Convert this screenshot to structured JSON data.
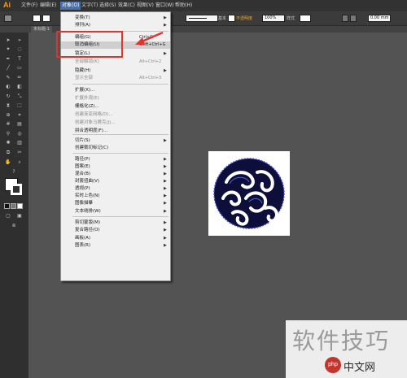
{
  "app": {
    "logo": "Ai"
  },
  "menubar": {
    "items": [
      "文件(F)",
      "编辑(E)",
      "对象(O)",
      "文字(T)",
      "选择(S)",
      "效果(C)",
      "视图(V)",
      "窗口(W)",
      "帮助(H)"
    ]
  },
  "controlbar": {
    "stroke_label": "基本",
    "opacity_label": "不透明度",
    "zoom_value": "100%",
    "style_label": "样式",
    "coord_value": "0.00 mm"
  },
  "tab": {
    "label": "未标题-1"
  },
  "object_menu": {
    "items": [
      {
        "label": "变换(T)",
        "shortcut": "",
        "submenu": true,
        "disabled": false
      },
      {
        "label": "排列(A)",
        "shortcut": "",
        "submenu": true,
        "disabled": false
      },
      {
        "label": "编组(G)",
        "shortcut": "Ctrl+G",
        "submenu": false,
        "disabled": false
      },
      {
        "label": "取消编组(U)",
        "shortcut": "Shift+Ctrl+G",
        "submenu": false,
        "disabled": false
      },
      {
        "label": "锁定(L)",
        "shortcut": "",
        "submenu": true,
        "disabled": false
      },
      {
        "label": "全部解锁(K)",
        "shortcut": "Alt+Ctrl+2",
        "submenu": false,
        "disabled": true
      },
      {
        "label": "隐藏(H)",
        "shortcut": "",
        "submenu": true,
        "disabled": false
      },
      {
        "label": "显示全部",
        "shortcut": "Alt+Ctrl+3",
        "submenu": false,
        "disabled": true
      },
      {
        "label": "扩展(X)...",
        "shortcut": "",
        "submenu": false,
        "disabled": false
      },
      {
        "label": "扩展外观(E)",
        "shortcut": "",
        "submenu": false,
        "disabled": true
      },
      {
        "label": "栅格化(Z)...",
        "shortcut": "",
        "submenu": false,
        "disabled": false
      },
      {
        "label": "创建渐变网格(D)...",
        "shortcut": "",
        "submenu": false,
        "disabled": true
      },
      {
        "label": "创建对象马赛克(J)...",
        "shortcut": "",
        "submenu": false,
        "disabled": true
      },
      {
        "label": "拼合透明度(F)...",
        "shortcut": "",
        "submenu": false,
        "disabled": false
      },
      {
        "label": "切片(S)",
        "shortcut": "",
        "submenu": true,
        "disabled": false
      },
      {
        "label": "创建裁切标记(C)",
        "shortcut": "",
        "submenu": false,
        "disabled": false
      },
      {
        "label": "路径(P)",
        "shortcut": "",
        "submenu": true,
        "disabled": false
      },
      {
        "label": "图案(E)",
        "shortcut": "",
        "submenu": true,
        "disabled": false
      },
      {
        "label": "混合(B)",
        "shortcut": "",
        "submenu": true,
        "disabled": false
      },
      {
        "label": "封套扭曲(V)",
        "shortcut": "",
        "submenu": true,
        "disabled": false
      },
      {
        "label": "透视(P)",
        "shortcut": "",
        "submenu": true,
        "disabled": false
      },
      {
        "label": "实时上色(N)",
        "shortcut": "",
        "submenu": true,
        "disabled": false
      },
      {
        "label": "图像描摹",
        "shortcut": "",
        "submenu": true,
        "disabled": false
      },
      {
        "label": "文本绕排(W)",
        "shortcut": "",
        "submenu": true,
        "disabled": false
      },
      {
        "label": "剪切蒙版(M)",
        "shortcut": "",
        "submenu": true,
        "disabled": false
      },
      {
        "label": "复合路径(O)",
        "shortcut": "",
        "submenu": true,
        "disabled": false
      },
      {
        "label": "画板(A)",
        "shortcut": "",
        "submenu": true,
        "disabled": false
      },
      {
        "label": "图表(R)",
        "shortcut": "",
        "submenu": true,
        "disabled": false
      }
    ]
  },
  "watermark": {
    "text": "软件技巧",
    "logo": "php",
    "site": "中文网"
  },
  "colors": {
    "highlight_box": "#e0342c",
    "app_logo": "#ff9a00",
    "artwork": "#0d0f3a"
  }
}
